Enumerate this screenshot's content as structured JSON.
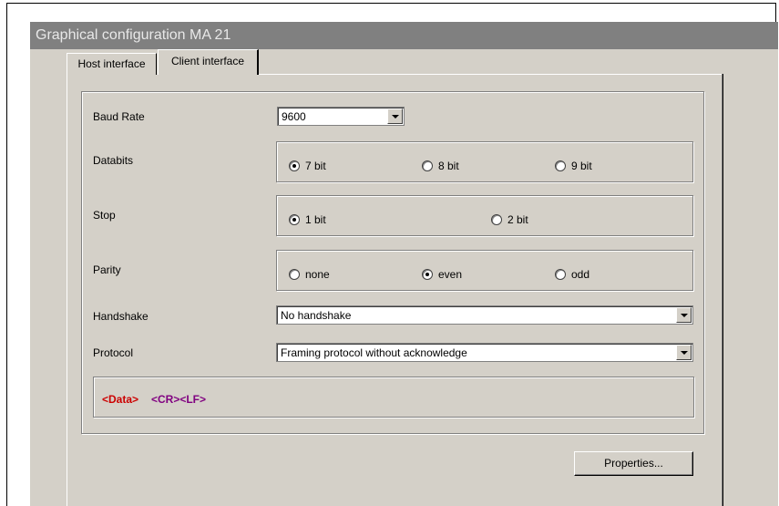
{
  "window": {
    "title": "Graphical configuration MA 21"
  },
  "tabs": [
    {
      "label": "Host interface",
      "active": false
    },
    {
      "label": "Client interface",
      "active": true
    }
  ],
  "baud_rate": {
    "label": "Baud Rate",
    "value": "9600"
  },
  "databits": {
    "label": "Databits",
    "options": [
      {
        "label": "7 bit",
        "checked": true
      },
      {
        "label": "8 bit",
        "checked": false
      },
      {
        "label": "9 bit",
        "checked": false
      }
    ]
  },
  "stop": {
    "label": "Stop",
    "options": [
      {
        "label": "1 bit",
        "checked": true
      },
      {
        "label": "2 bit",
        "checked": false
      }
    ]
  },
  "parity": {
    "label": "Parity",
    "options": [
      {
        "label": "none",
        "checked": false
      },
      {
        "label": "even",
        "checked": true
      },
      {
        "label": "odd",
        "checked": false
      }
    ]
  },
  "handshake": {
    "label": "Handshake",
    "value": "No handshake"
  },
  "protocol": {
    "label": "Protocol",
    "value": "Framing protocol without acknowledge"
  },
  "frame_format": {
    "data": "<Data>",
    "terminator": "<CR><LF>",
    "data_color": "#cc0000",
    "terminator_color": "#800080"
  },
  "buttons": {
    "properties": "Properties..."
  }
}
